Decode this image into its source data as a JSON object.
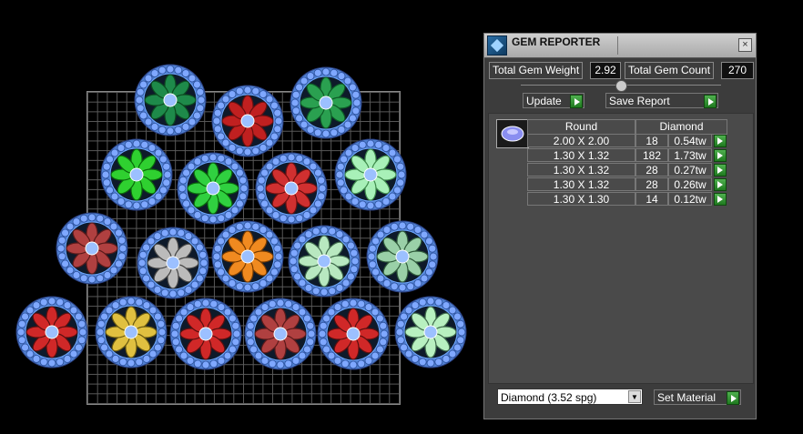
{
  "panel": {
    "title": "GEM REPORTER",
    "close_label": "×",
    "total_weight_label": "Total Gem Weight",
    "total_weight_value": "2.92",
    "total_count_label": "Total Gem Count",
    "total_count_value": "270",
    "update_label": "Update",
    "save_report_label": "Save Report",
    "table": {
      "shape_header": "Round",
      "material_header": "Diamond",
      "rows": [
        {
          "size": "2.00 X 2.00",
          "count": "18",
          "weight": "0.54tw"
        },
        {
          "size": "1.30 X 1.32",
          "count": "182",
          "weight": "1.73tw"
        },
        {
          "size": "1.30 X 1.32",
          "count": "28",
          "weight": "0.27tw"
        },
        {
          "size": "1.30 X 1.32",
          "count": "28",
          "weight": "0.26tw"
        },
        {
          "size": "1.30 X 1.30",
          "count": "14",
          "weight": "0.12tw"
        }
      ]
    },
    "material_select_value": "Diamond    (3.52 spg)",
    "set_material_label": "Set Material"
  },
  "colors": {
    "panel_bg": "#3c3c3c",
    "accent_green": "#2a8f2a",
    "gem_blue": "#7fa8ff"
  },
  "icons": [
    "app-icon",
    "close-icon",
    "go-arrow-icon",
    "round-gem-icon",
    "dropdown-arrow-icon"
  ]
}
